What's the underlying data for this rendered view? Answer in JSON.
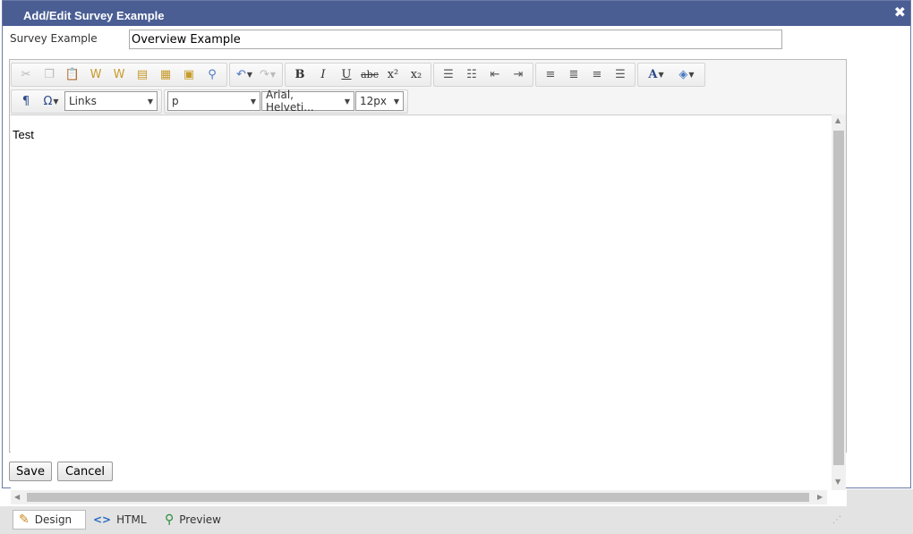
{
  "dialog": {
    "title": "Add/Edit Survey Example",
    "close_glyph": "✖"
  },
  "form": {
    "label": "Survey Example",
    "value": "Overview Example"
  },
  "editor": {
    "toolbar1": {
      "icons": [
        "cut-icon",
        "copy-icon",
        "paste-icon",
        "paste-word-icon",
        "paste-plain-icon",
        "paste-html-icon",
        "paste-special-icon",
        "find-icon",
        "undo-icon",
        "redo-icon",
        "bold-icon",
        "italic-icon",
        "underline-icon",
        "strike-icon",
        "superscript-icon",
        "subscript-icon",
        "ordered-list-icon",
        "unordered-list-icon",
        "outdent-icon",
        "indent-icon",
        "align-left-icon",
        "align-center-icon",
        "align-right-icon",
        "justify-icon",
        "font-color-icon",
        "highlight-color-icon"
      ]
    },
    "toolbar2": {
      "links_value": "Links",
      "format_value": "p",
      "font_value": "Arial, Helveti...",
      "size_value": "12px"
    },
    "content_text": "Test"
  },
  "buttons": {
    "save": "Save",
    "cancel": "Cancel"
  },
  "modes": {
    "design": "Design",
    "html": "HTML",
    "preview": "Preview",
    "active": "design"
  },
  "colors": {
    "titlebar": "#4a5e94",
    "accent_blue": "#4a78c2"
  }
}
